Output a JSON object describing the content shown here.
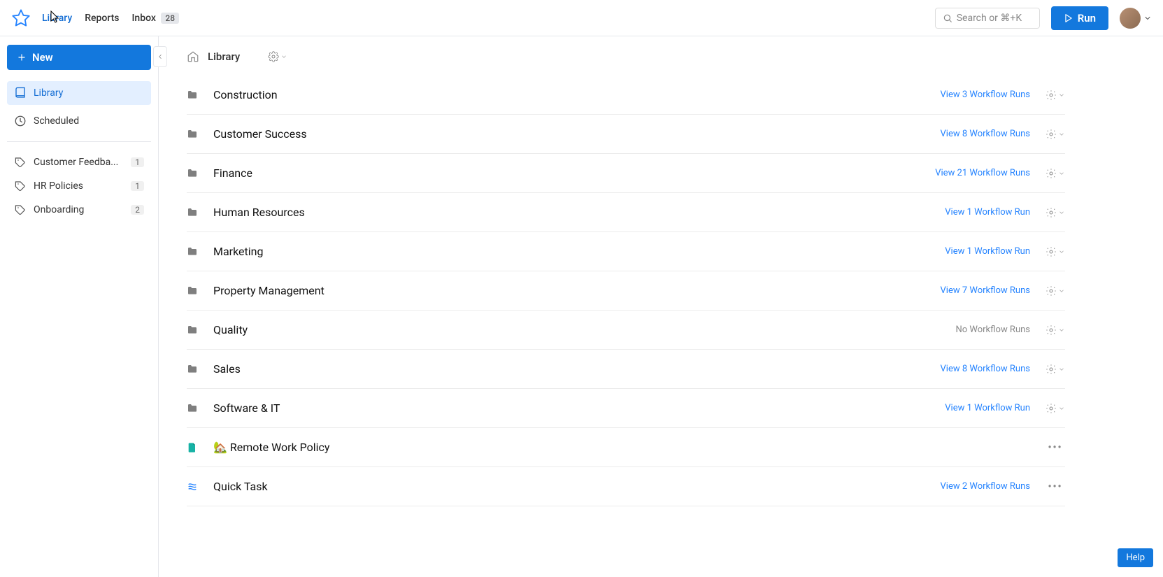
{
  "header": {
    "nav": {
      "library": "Library",
      "reports": "Reports",
      "inbox": "Inbox",
      "inbox_count": "28"
    },
    "search_placeholder": "Search or ⌘+K",
    "run_button": "Run"
  },
  "sidebar": {
    "new_button": "New",
    "library": "Library",
    "scheduled": "Scheduled",
    "tags": [
      {
        "label": "Customer Feedba...",
        "count": "1"
      },
      {
        "label": "HR Policies",
        "count": "1"
      },
      {
        "label": "Onboarding",
        "count": "2"
      }
    ]
  },
  "breadcrumb": {
    "title": "Library"
  },
  "rows": [
    {
      "type": "folder",
      "name": "Construction",
      "runs": "View 3 Workflow Runs"
    },
    {
      "type": "folder",
      "name": "Customer Success",
      "runs": "View 8 Workflow Runs"
    },
    {
      "type": "folder",
      "name": "Finance",
      "runs": "View 21 Workflow Runs"
    },
    {
      "type": "folder",
      "name": "Human Resources",
      "runs": "View 1 Workflow Run"
    },
    {
      "type": "folder",
      "name": "Marketing",
      "runs": "View 1 Workflow Run"
    },
    {
      "type": "folder",
      "name": "Property Management",
      "runs": "View 7 Workflow Runs"
    },
    {
      "type": "folder",
      "name": "Quality",
      "runs": "No Workflow Runs",
      "muted": true
    },
    {
      "type": "folder",
      "name": "Sales",
      "runs": "View 8 Workflow Runs"
    },
    {
      "type": "folder",
      "name": "Software & IT",
      "runs": "View 1 Workflow Run"
    },
    {
      "type": "doc",
      "name": "🏡 Remote Work Policy"
    },
    {
      "type": "workflow",
      "name": "Quick Task",
      "runs": "View 2 Workflow Runs"
    }
  ],
  "help_button": "Help"
}
